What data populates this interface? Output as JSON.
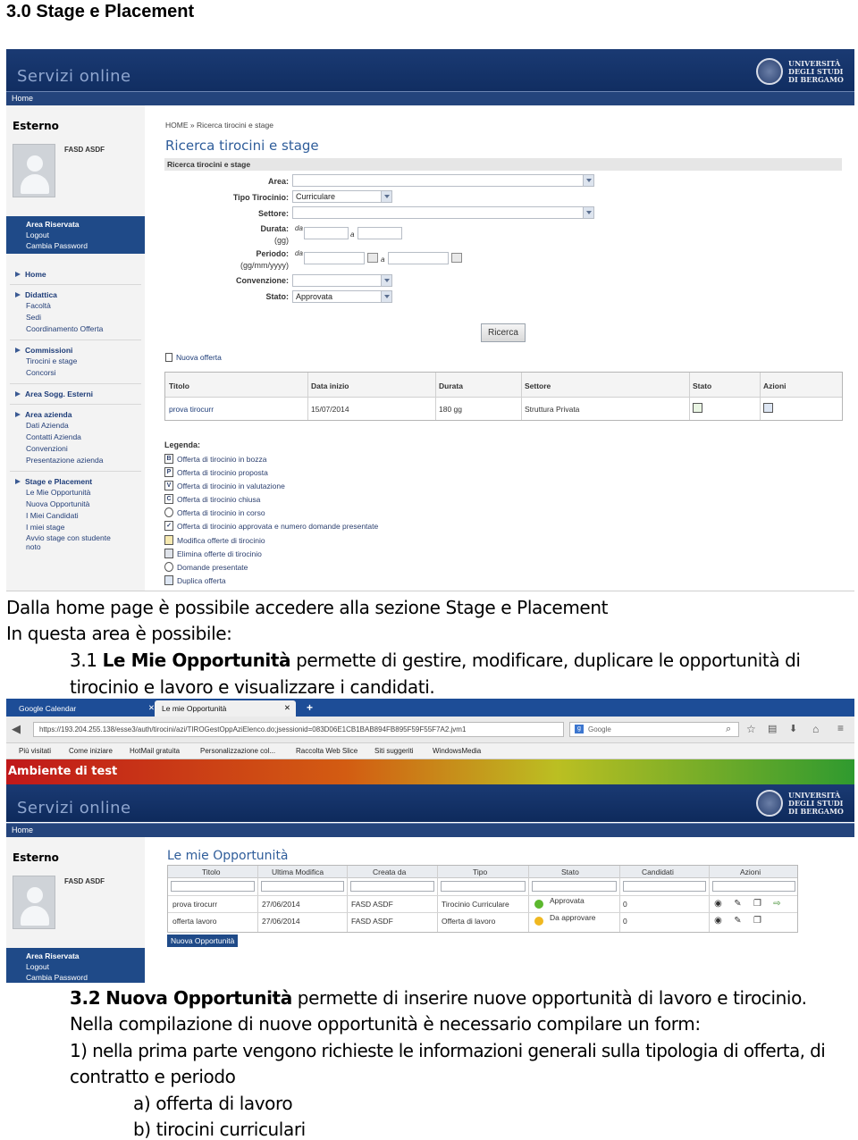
{
  "heading": "3.0 Stage e Placement",
  "shot1": {
    "banner_title": "Servizi online",
    "university": [
      "UNIVERSITÀ",
      "DEGLI STUDI",
      "DI BERGAMO"
    ],
    "nav_home": "Home",
    "sidebar": {
      "role": "Esterno",
      "user": "FASD ASDF",
      "area": [
        "Area Riservata",
        "Logout",
        "Cambia Password"
      ],
      "menu": [
        {
          "title": "Home",
          "items": []
        },
        {
          "title": "Didattica",
          "items": [
            "Facoltà",
            "Sedi",
            "Coordinamento Offerta"
          ]
        },
        {
          "title": "Commissioni",
          "items": [
            "Tirocini e stage",
            "Concorsi"
          ]
        },
        {
          "title": "Area Sogg. Esterni",
          "items": []
        },
        {
          "title": "Area azienda",
          "items": [
            "Dati Azienda",
            "Contatti Azienda",
            "Convenzioni",
            "Presentazione azienda"
          ]
        },
        {
          "title": "Stage e Placement",
          "items": [
            "Le Mie Opportunità",
            "Nuova Opportunità",
            "I Miei Candidati",
            "I miei stage",
            "Avvio stage con studente",
            "noto"
          ]
        }
      ]
    },
    "breadcrumb": "HOME » Ricerca tirocini e stage",
    "page_title": "Ricerca tirocini e stage",
    "section": "Ricerca tirocini e stage",
    "form": {
      "area_label": "Area:",
      "tipo_label": "Tipo Tirocinio:",
      "tipo_value": "Curriculare",
      "settore_label": "Settore:",
      "durata_label": "Durata:",
      "durata_unit": "(gg)",
      "periodo_label": "Periodo:",
      "periodo_unit": "(gg/mm/yyyy)",
      "da": "da",
      "a": "a",
      "convenzione_label": "Convenzione:",
      "stato_label": "Stato:",
      "stato_value": "Approvata",
      "search_button": "Ricerca"
    },
    "new_offer": "Nuova offerta",
    "table": {
      "headers": [
        "Titolo",
        "Data inizio",
        "Durata",
        "Settore",
        "Stato",
        "Azioni"
      ],
      "row": [
        "prova tirocurr",
        "15/07/2014",
        "180 gg",
        "Struttura Privata"
      ]
    },
    "legend_title": "Legenda:",
    "legend": [
      "Offerta di tirocinio in bozza",
      "Offerta di tirocinio proposta",
      "Offerta di tirocinio in valutazione",
      "Offerta di tirocinio chiusa",
      "Offerta di tirocinio in corso",
      "Offerta di tirocinio approvata e numero domande presentate",
      "Modifica offerte di tirocinio",
      "Elimina offerte di tirocinio",
      "Domande presentate",
      "Duplica offerta"
    ]
  },
  "para1": {
    "line1": "Dalla home page è possibile accedere alla sezione Stage e Placement",
    "line2": "In questa area è possibile:",
    "item_num": "3.1",
    "item_bold": "Le Mie Opportunità",
    "item_rest": "permette di gestire, modificare, duplicare le opportunità di",
    "item_cont": "tirocinio e lavoro e visualizzare i candidati."
  },
  "shot2": {
    "tabs": [
      "Google Calendar",
      "Le mie Opportunità"
    ],
    "url": "https://193.204.255.138/esse3/auth/tirocini/azi/TIROGestOppAziElenco.do;jsessionid=083D06E1CB1BAB894FB895F59F55F7A2.jvm1",
    "search_placeholder": "Google",
    "bookmarks": [
      "Più visitati",
      "Come iniziare",
      "HotMail gratuita",
      "Personalizzazione col...",
      "Raccolta Web Slice",
      "Siti suggeriti",
      "WindowsMedia"
    ],
    "env": "Ambiente di test",
    "banner_title": "Servizi online",
    "nav_home": "Home",
    "role": "Esterno",
    "user": "FASD ASDF",
    "area": [
      "Area Riservata",
      "Logout",
      "Cambia Password"
    ],
    "page_title": "Le mie Opportunità",
    "grid_headers": [
      "Titolo",
      "Ultima Modifica",
      "Creata da",
      "Tipo",
      "Stato",
      "Candidati",
      "Azioni"
    ],
    "rows": [
      {
        "titolo": "prova tirocurr",
        "data": "27/06/2014",
        "creata": "FASD ASDF",
        "tipo": "Tirocinio Curriculare",
        "stato": "Approvata",
        "stato_color": "#5cb82e",
        "candidati": "0"
      },
      {
        "titolo": "offerta lavoro",
        "data": "27/06/2014",
        "creata": "FASD ASDF",
        "tipo": "Offerta di lavoro",
        "stato": "Da approvare",
        "stato_color": "#f0b820",
        "candidati": "0"
      }
    ],
    "new_button": "Nuova Opportunità"
  },
  "para2": {
    "item_num": "3.2",
    "item_bold": "Nuova Opportunità",
    "item_rest": "permette di inserire nuove opportunità di lavoro e tirocinio.",
    "line2": "Nella compilazione di nuove opportunità è necessario compilare un form:",
    "line3": "1) nella prima parte vengono richieste le informazioni generali sulla tipologia di offerta, di",
    "line4": "contratto e periodo",
    "sub_a": "a) offerta di lavoro",
    "sub_b": "b) tirocini curriculari"
  }
}
